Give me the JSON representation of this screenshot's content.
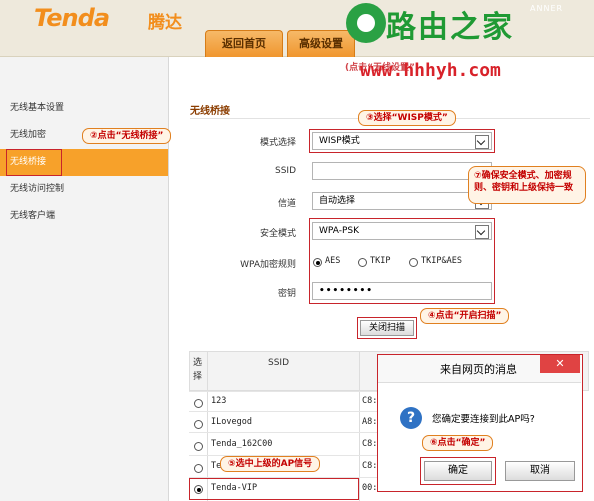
{
  "header": {
    "logo_en": "Tenda",
    "logo_cn": "腾达",
    "tabs": [
      "返回首页",
      "高级设置"
    ],
    "partial_text": "ANNER"
  },
  "watermark": {
    "text": "路由之家",
    "url": "www.hhhyh.com",
    "overlay_text": "(点击“无线设置”",
    "color": "#1f9a34",
    "url_color": "#d8222a"
  },
  "sidebar": {
    "items": [
      "无线基本设置",
      "无线加密",
      "无线桥接",
      "无线访问控制",
      "无线客户端"
    ],
    "active_index": 2
  },
  "page": {
    "title": "无线桥接"
  },
  "form": {
    "mode_label": "模式选择",
    "mode_value": "WISP模式",
    "ssid_label": "SSID",
    "ssid_value": "",
    "channel_label": "信道",
    "channel_value": "自动选择",
    "security_label": "安全模式",
    "security_value": "WPA-PSK",
    "cipher_label": "WPA加密规则",
    "cipher_options": [
      "AES",
      "TKIP",
      "TKIP&AES"
    ],
    "cipher_selected": "AES",
    "key_label": "密钥",
    "key_value": "••••••••",
    "scan_button": "关闭扫描"
  },
  "table": {
    "headers": [
      "选择",
      "SSID"
    ],
    "rows": [
      {
        "ssid": "123",
        "extra": "C8:"
      },
      {
        "ssid": "ILovegod",
        "extra": "A8:"
      },
      {
        "ssid": "Tenda_162C00",
        "extra": "C8:"
      },
      {
        "ssid": "Te",
        "extra": "C8:"
      },
      {
        "ssid": "Tenda-VIP",
        "extra": "00:"
      }
    ],
    "selected_index": 4
  },
  "callouts": {
    "c2": "②点击“无线桥接”",
    "c3": "③选择“WISP模式”",
    "c4": "④点击“开启扫描”",
    "c5": "⑤选中上级的AP信号",
    "c6": "⑥点击“确定”",
    "c7": "⑦确保安全模式、加密规则、密钥和上级保持一致"
  },
  "dialog": {
    "title": "来自网页的消息",
    "message": "您确定要连接到此AP吗?",
    "ok": "确定",
    "cancel": "取消",
    "close_glyph": "✕",
    "info_glyph": "?"
  },
  "colors": {
    "accent": "#f7a12a",
    "annotation": "#c8242b"
  }
}
